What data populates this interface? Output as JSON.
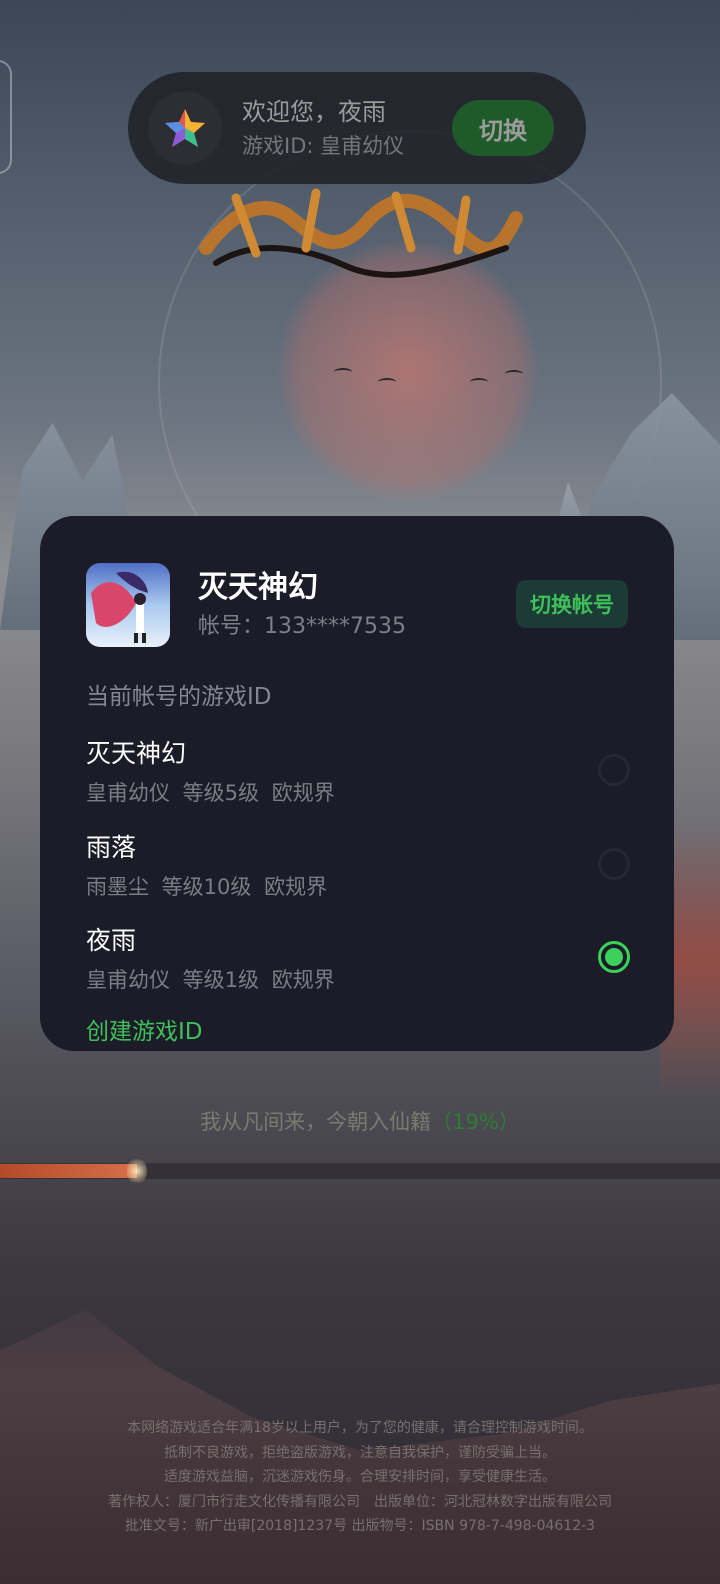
{
  "welcome": {
    "greeting": "欢迎您，夜雨",
    "game_id": "游戏ID: 皇甫幼仪",
    "switch_label": "切换"
  },
  "card": {
    "game_title": "灭天神幻",
    "account": "帐号：133****7535",
    "switch_account_label": "切换帐号",
    "section_title": "当前帐号的游戏ID",
    "ids": [
      {
        "name": "灭天神幻",
        "meta": "皇甫幼仪 等级5级 欧规界",
        "selected": false
      },
      {
        "name": "雨落",
        "meta": "雨墨尘 等级10级 欧规界",
        "selected": false
      },
      {
        "name": "夜雨",
        "meta": "皇甫幼仪 等级1级 欧规界",
        "selected": true
      }
    ],
    "create_label": "创建游戏ID"
  },
  "loading": {
    "text": "我从凡间来，今朝入仙籍",
    "percent_label": "（19%）",
    "progress": 0.19
  },
  "footer": {
    "lines": [
      "本网络游戏适合年满18岁以上用户，为了您的健康，请合理控制游戏时间。",
      "抵制不良游戏，拒绝盗版游戏，注意自我保护，谨防受骗上当。",
      "适度游戏益脑，沉迷游戏伤身。合理安排时间，享受健康生活。",
      "著作权人：厦门市行走文化传播有限公司　出版单位：河北冠林数字出版有限公司",
      "批准文号：新广出审[2018]1237号 出版物号：ISBN 978-7-498-04612-3"
    ]
  },
  "colors": {
    "accent_green": "#3bd15b",
    "card_bg": "#1b1c28",
    "switch_btn": "#1f5a2a"
  }
}
